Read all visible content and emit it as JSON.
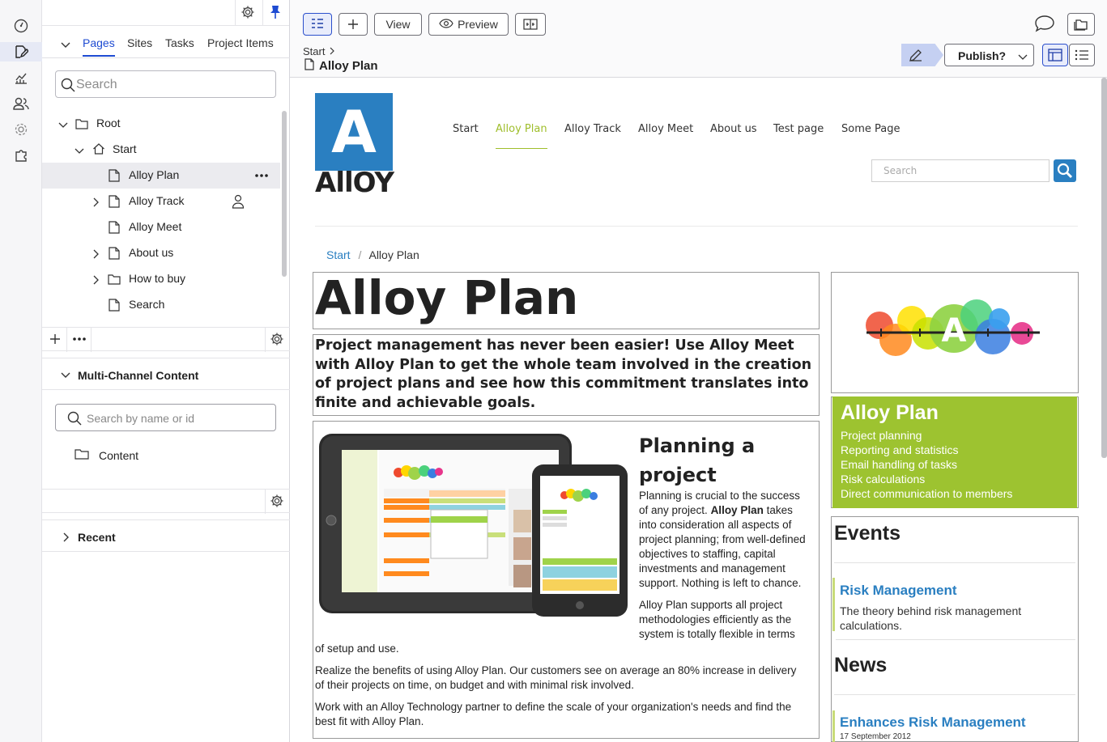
{
  "rail": {
    "items": [
      "dashboard-icon",
      "edit-icon",
      "analytics-icon",
      "users-icon",
      "settings-icon",
      "addons-icon"
    ]
  },
  "tree_panel": {
    "tabs": [
      "Pages",
      "Sites",
      "Tasks",
      "Project Items"
    ],
    "search_placeholder": "Search",
    "nodes": [
      {
        "label": "Root"
      },
      {
        "label": "Start"
      },
      {
        "label": "Alloy Plan"
      },
      {
        "label": "Alloy Track"
      },
      {
        "label": "Alloy Meet"
      },
      {
        "label": "About us"
      },
      {
        "label": "How to buy"
      },
      {
        "label": "Search"
      }
    ],
    "multi_channel_title": "Multi-Channel Content",
    "mc_search_placeholder": "Search by name or id",
    "content_folder": "Content",
    "recent_title": "Recent"
  },
  "toolbar": {
    "view_label": "View",
    "preview_label": "Preview",
    "breadcrumb": "Start",
    "page_title": "Alloy Plan",
    "publish_label": "Publish?"
  },
  "site": {
    "logo_letter": "A",
    "logo_text": "AllOY",
    "nav": [
      "Start",
      "Alloy Plan",
      "Alloy Track",
      "Alloy Meet",
      "About us",
      "Test page",
      "Some Page"
    ],
    "search_placeholder": "Search",
    "breadcrumb": {
      "start": "Start",
      "sep": "/",
      "current": "Alloy Plan"
    },
    "heading": "Alloy Plan",
    "intro": "Project management has never been easier! Use Alloy Meet with Alloy Plan to get the whole team involved in the creation of project plans and see how this commitment translates into finite and achievable goals.",
    "article_heading_1": "Planning a",
    "article_heading_2": "project",
    "p1a": "Planning is crucial to the success",
    "p1b_pre": "of any project. ",
    "p1b_bold": "Alloy Plan",
    "p1b_post": " takes",
    "p1c": "into consideration all aspects of",
    "p1d": "project planning; from well-defined",
    "p1e": "objectives to staffing, capital",
    "p1f": "investments and management",
    "p1g": "support. Nothing is left to chance.",
    "p2a": "Alloy Plan supports all project",
    "p2b": "methodologies efficiently as the",
    "p2c": "system is totally flexible in terms",
    "p2d": "of setup and use.",
    "p3": "Realize the benefits of using Alloy Plan. Our customers see on average an 80% increase in delivery of their projects on time, on budget and with minimal risk involved.",
    "p4": "Work with an Alloy Technology partner to define the scale of your organization's needs and find the best fit with Alloy Plan.",
    "plan_box": {
      "title": "Alloy Plan",
      "items": [
        "Project planning",
        "Reporting and statistics",
        "Email handling of tasks",
        "Risk calculations",
        "Direct communication to members"
      ]
    },
    "events_title": "Events",
    "event": {
      "title": "Risk Management",
      "text1": "The theory behind risk management",
      "text2": "calculations."
    },
    "news_title": "News",
    "news": {
      "title": "Enhances Risk Management",
      "date": "17 September 2012"
    }
  }
}
